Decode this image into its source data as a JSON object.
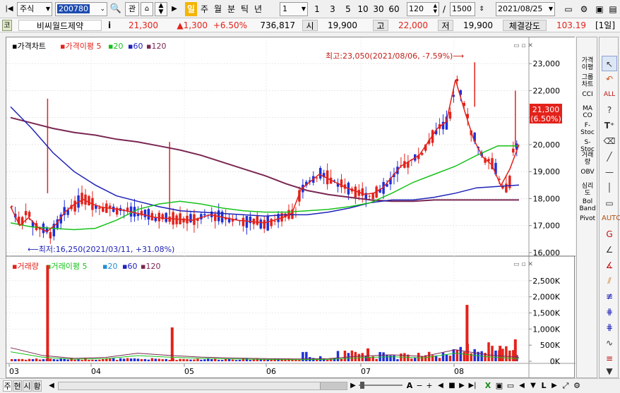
{
  "toolbar": {
    "market": "주식",
    "code": "200780",
    "gwan": "관",
    "periods": [
      "일",
      "주",
      "월",
      "분",
      "틱",
      "년"
    ],
    "active_period": "일",
    "interval": "1",
    "interval_buttons": [
      "1",
      "3",
      "5",
      "10",
      "30",
      "60"
    ],
    "count": "120",
    "total": "1500",
    "date": "2021/08/25"
  },
  "info": {
    "code_badge": "코",
    "name": "비씨월드제약",
    "info_icon": "i",
    "price": "21,300",
    "change": "▲1,300",
    "change_pct": "+6.50%",
    "volume": "736,817",
    "open_label": "시",
    "open": "19,900",
    "high_label": "고",
    "high": "22,000",
    "low_label": "저",
    "low": "19,900",
    "strength_label": "체결강도",
    "strength": "103.19",
    "period_badge": "[1일]"
  },
  "price_panel": {
    "legend_main": "가격차트",
    "legend_ma_label": "가격이평 5",
    "ma_periods": [
      "20",
      "60",
      "120"
    ],
    "max_annotation": "최고:23,050(2021/08/06, -7.59%)⟶",
    "min_annotation": "⟵최저:16,250(2021/03/11, +31.08%)",
    "current_price_tag": "21,300",
    "current_pct_tag": "(6.50%)",
    "y_ticks": [
      "23,000",
      "22,000",
      "21,000",
      "20,000",
      "19,000",
      "18,000",
      "17,000",
      "16,000"
    ]
  },
  "volume_panel": {
    "legend_main": "거래량",
    "legend_ma_label": "거래이평 5",
    "ma_periods": [
      "20",
      "60",
      "120"
    ],
    "y_ticks": [
      "2,500K",
      "2,000K",
      "1,500K",
      "1,000K",
      "500K",
      "0K"
    ]
  },
  "x_labels": [
    "03",
    "04",
    "05",
    "06",
    "07",
    "08"
  ],
  "sidebar_indicators": [
    "가격\n이평",
    "그룹\n차트",
    "CCI",
    "MA\nCO",
    "F-\nStoc",
    "S-\nStoc",
    "거래\n량",
    "OBV",
    "심리\n도",
    "Bol\nBand",
    "Pivot"
  ],
  "bottom": {
    "tabs": [
      "주",
      "현",
      "시",
      "황"
    ],
    "right_letters": [
      "A",
      "L"
    ]
  },
  "colors": {
    "up": "#e3221b",
    "down": "#1f2fd6",
    "ma5": "#e3221b",
    "ma20": "#17c21a",
    "ma60": "#1e22b8",
    "ma120": "#7a2752",
    "accent_period": "#f5b400"
  },
  "chart_data": {
    "type": "candlestick",
    "y_range": [
      16000,
      23500
    ],
    "max": {
      "value": 23050,
      "date": "2021/08/06"
    },
    "min": {
      "value": 16250,
      "date": "2021/03/11"
    },
    "last": {
      "value": 21300,
      "pct": 6.5
    },
    "ma20": [
      17100,
      16950,
      16900,
      16850,
      16900,
      17200,
      17600,
      17800,
      17900,
      17800,
      17650,
      17550,
      17500,
      17500,
      17550,
      17600,
      17700,
      17850,
      18200,
      18600,
      18900,
      19200,
      19600,
      19950,
      19950
    ],
    "ma60": [
      21400,
      20600,
      19700,
      19000,
      18500,
      18100,
      17900,
      17700,
      17550,
      17500,
      17450,
      17400,
      17350,
      17400,
      17400,
      17500,
      17650,
      17850,
      17950,
      17950,
      18050,
      18200,
      18400,
      18450,
      18500
    ],
    "ma120": [
      21000,
      20800,
      20600,
      20450,
      20350,
      20200,
      20100,
      19950,
      19800,
      19600,
      19350,
      19100,
      18850,
      18550,
      18300,
      18150,
      18050,
      17950,
      17900,
      17900,
      17950,
      17950,
      17950,
      17950,
      17950
    ],
    "volume_ma_levels_k": [
      420,
      180,
      90,
      120,
      250,
      180,
      130,
      100,
      80,
      70,
      80,
      160,
      200,
      150,
      360,
      200,
      120
    ]
  }
}
